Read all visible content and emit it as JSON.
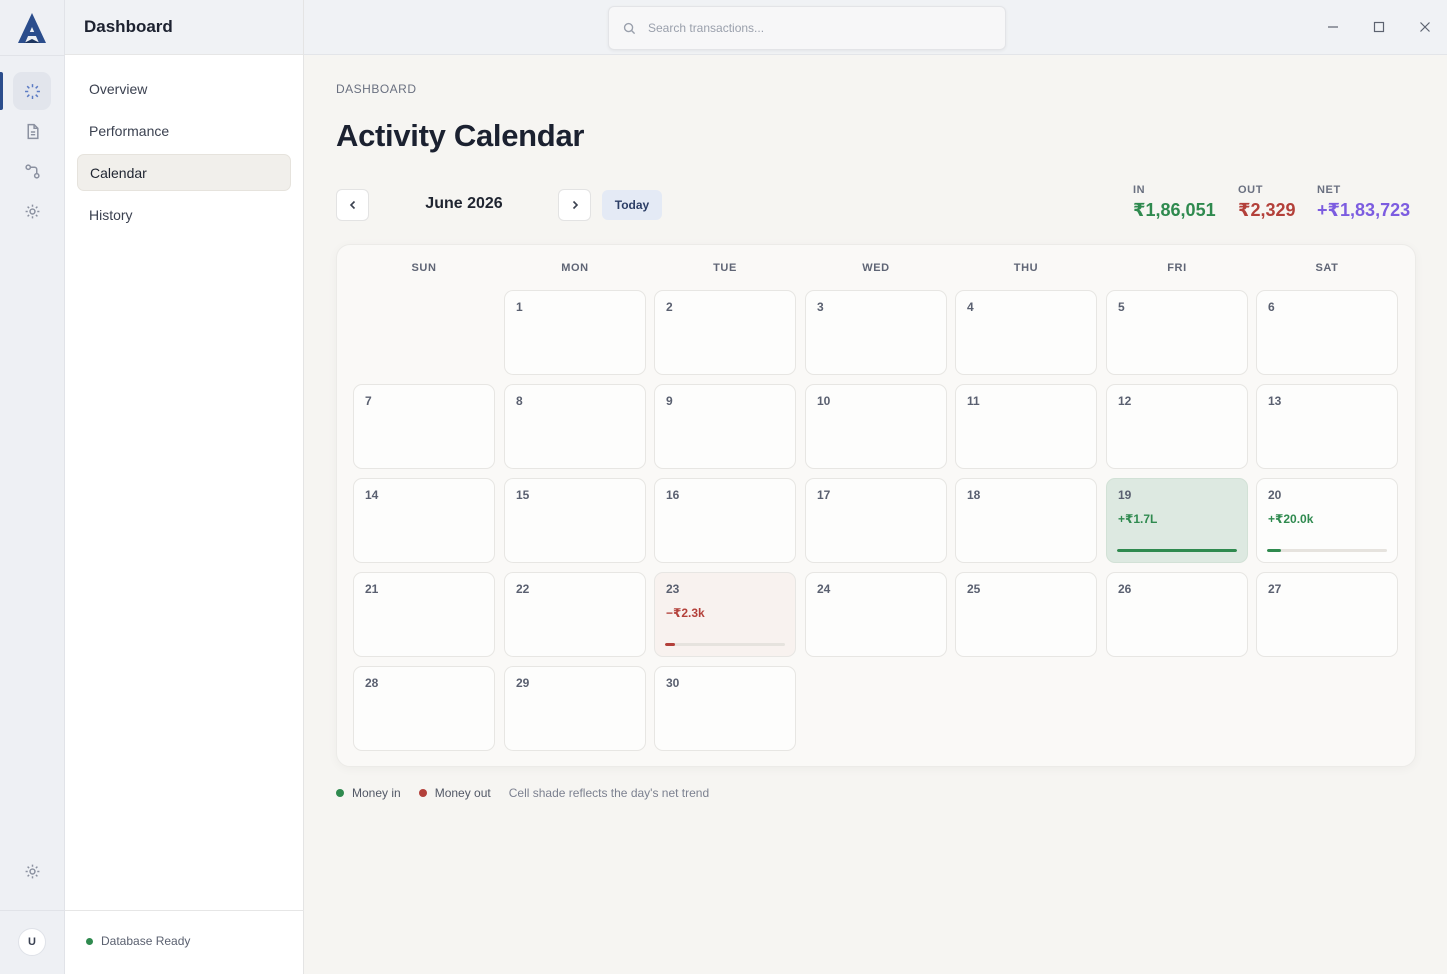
{
  "app": {
    "logo_letter": "A"
  },
  "search": {
    "placeholder": "Search transactions..."
  },
  "sidebar": {
    "title": "Dashboard",
    "items": [
      {
        "label": "Overview"
      },
      {
        "label": "Performance"
      },
      {
        "label": "Calendar",
        "active": true
      },
      {
        "label": "History"
      }
    ],
    "status": "Database Ready"
  },
  "rail": {
    "icons": [
      "loader-icon",
      "document-icon",
      "flow-icon",
      "settings-icon"
    ],
    "bottom_icon": "settings-icon",
    "avatar_initial": "U"
  },
  "main": {
    "breadcrumb": "DASHBOARD",
    "title": "Activity Calendar",
    "month": "June 2026",
    "today_label": "Today",
    "summary": {
      "in_label": "IN",
      "in_value": "₹1,86,051",
      "out_label": "OUT",
      "out_value": "₹2,329",
      "net_label": "NET",
      "net_value": "+₹1,83,723"
    }
  },
  "calendar": {
    "weekdays": [
      "SUN",
      "MON",
      "TUE",
      "WED",
      "THU",
      "FRI",
      "SAT"
    ],
    "first_weekday_index": 1,
    "days": [
      {
        "d": "1"
      },
      {
        "d": "2"
      },
      {
        "d": "3"
      },
      {
        "d": "4"
      },
      {
        "d": "5"
      },
      {
        "d": "6"
      },
      {
        "d": "7"
      },
      {
        "d": "8"
      },
      {
        "d": "9"
      },
      {
        "d": "10"
      },
      {
        "d": "11"
      },
      {
        "d": "12"
      },
      {
        "d": "13"
      },
      {
        "d": "14"
      },
      {
        "d": "15"
      },
      {
        "d": "16"
      },
      {
        "d": "17"
      },
      {
        "d": "18"
      },
      {
        "d": "19",
        "amount": "+₹1.7L",
        "kind": "in",
        "level": 1.0,
        "shade": "strong"
      },
      {
        "d": "20",
        "amount": "+₹20.0k",
        "kind": "in",
        "level": 0.12
      },
      {
        "d": "21"
      },
      {
        "d": "22"
      },
      {
        "d": "23",
        "amount": "−₹2.3k",
        "kind": "out",
        "level": 0.08,
        "shade": "neg-light"
      },
      {
        "d": "24"
      },
      {
        "d": "25"
      },
      {
        "d": "26"
      },
      {
        "d": "27"
      },
      {
        "d": "28"
      },
      {
        "d": "29"
      },
      {
        "d": "30"
      }
    ]
  },
  "legend": {
    "money_in": "Money in",
    "money_out": "Money out",
    "note": "Cell shade reflects the day's net trend"
  },
  "colors": {
    "in": "#2f8a4f",
    "out": "#b3403a",
    "net": "#7c5ce0",
    "accent": "#2b4d8c"
  }
}
